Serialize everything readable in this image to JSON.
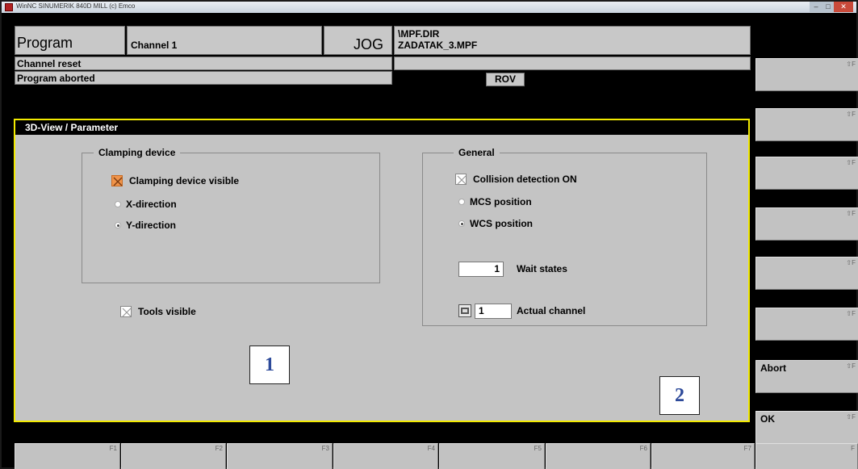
{
  "window": {
    "title": "WinNC SINUMERIK 840D MILL (c) Emco",
    "buttons": {
      "minimize": "–",
      "maximize": "□",
      "close": "✕"
    }
  },
  "header": {
    "area": "Program",
    "channel": "Channel 1",
    "mode": "JOG",
    "path_dir": "\\MPF.DIR",
    "path_file": "ZADATAK_3.MPF",
    "status1": "Channel reset",
    "status2": "Program aborted",
    "rov": "ROV"
  },
  "panel": {
    "title": "3D-View / Parameter",
    "clamping": {
      "legend": "Clamping device",
      "visible_label": "Clamping device visible",
      "visible_checked": true,
      "x_label": "X-direction",
      "y_label": "Y-direction",
      "selected": "Y-direction"
    },
    "tools_visible_label": "Tools visible",
    "tools_visible_checked": true,
    "general": {
      "legend": "General",
      "collision_label": "Collision detection ON",
      "collision_checked": true,
      "mcs_label": "MCS position",
      "wcs_label": "WCS position",
      "selected": "WCS position",
      "wait_states_value": "1",
      "wait_states_label": "Wait states",
      "actual_channel_value": "1",
      "actual_channel_label": "Actual channel"
    }
  },
  "callouts": {
    "one": "1",
    "two": "2"
  },
  "right_softkeys": [
    {
      "label": "",
      "fn": "⇧F"
    },
    {
      "label": "",
      "fn": "⇧F"
    },
    {
      "label": "",
      "fn": "⇧F"
    },
    {
      "label": "",
      "fn": "⇧F"
    },
    {
      "label": "",
      "fn": "⇧F"
    },
    {
      "label": "",
      "fn": "⇧F"
    },
    {
      "label": "Abort",
      "fn": "⇧F"
    },
    {
      "label": "OK",
      "fn": "⇧F"
    }
  ],
  "bottom_softkeys": [
    {
      "fn": "F1"
    },
    {
      "fn": "F2"
    },
    {
      "fn": "F3"
    },
    {
      "fn": "F4"
    },
    {
      "fn": "F5"
    },
    {
      "fn": "F6"
    },
    {
      "fn": "F7"
    },
    {
      "fn": "F"
    }
  ],
  "colors": {
    "highlight": "#f2ea00",
    "panel": "#c4c4c4",
    "checkbox_active": "#f0944a",
    "callout_text": "#2d4a9a"
  }
}
